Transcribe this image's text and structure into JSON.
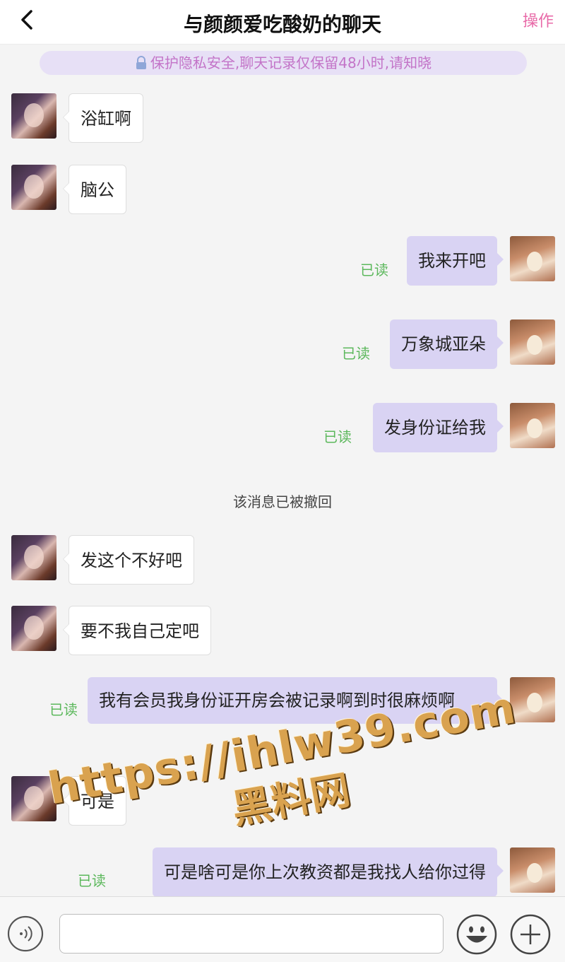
{
  "header": {
    "title": "与颜颜爱吃酸奶的聊天",
    "action_label": "操作",
    "back_icon": "chevron-left-icon"
  },
  "notice": {
    "text": "保护隐私安全,聊天记录仅保留48小时,请知晓",
    "icon": "lock-icon"
  },
  "messages": [
    {
      "side": "left",
      "text": "浴缸啊"
    },
    {
      "side": "left",
      "text": "脑公"
    },
    {
      "side": "right",
      "text": "我来开吧",
      "status": "已读"
    },
    {
      "side": "right",
      "text": "万象城亚朵",
      "status": "已读"
    },
    {
      "side": "right",
      "text": "发身份证给我",
      "status": "已读"
    },
    {
      "side": "system",
      "text": "该消息已被撤回"
    },
    {
      "side": "left",
      "text": "发这个不好吧"
    },
    {
      "side": "left",
      "text": "要不我自己定吧"
    },
    {
      "side": "right",
      "text": "我有会员我身份证开房会被记录啊到时很麻烦啊",
      "status": "已读"
    },
    {
      "side": "left",
      "text": "可是"
    },
    {
      "side": "right",
      "text": "可是啥可是你上次教资都是我找人给你过得",
      "status": "已读"
    }
  ],
  "watermark": {
    "line1": "https://ihlw39.com",
    "line2": "黑料网"
  },
  "input_bar": {
    "placeholder": "",
    "voice_icon": "voice-icon",
    "emoji_icon": "emoji-icon",
    "plus_icon": "plus-icon"
  },
  "colors": {
    "accent": "#e86aa8",
    "notice_bg": "#e7e0f6",
    "notice_text": "#c374c8",
    "sent_bubble": "#d9d3f3",
    "read_status": "#5cb85c"
  }
}
